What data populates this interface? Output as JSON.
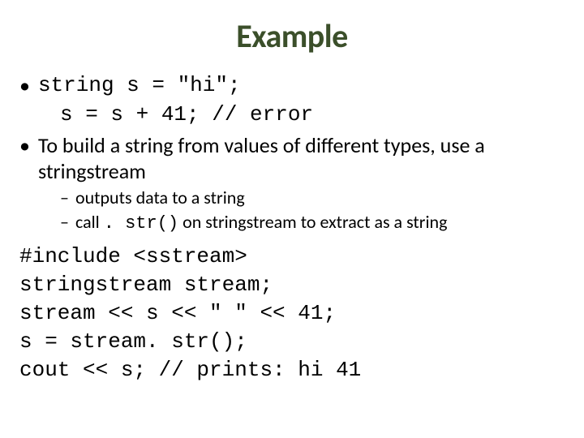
{
  "title": "Example",
  "b1": "string s = \"hi\";",
  "b1_sub": "s = s + 41;    // error",
  "b2": "To build a string from values of different types, use a stringstream",
  "s1": "outputs data to a string",
  "s2_a": "call ",
  "s2_code": ". str()",
  "s2_b": "  on stringstream to extract as a string",
  "code1": "#include <sstream>",
  "code2": "stringstream stream;",
  "code3": "stream << s << \" \"  << 41;",
  "code4": "s = stream. str();",
  "code5": "cout << s;  // prints: hi 41"
}
